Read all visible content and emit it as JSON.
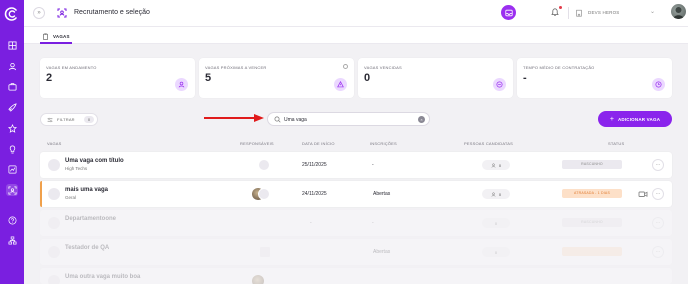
{
  "header": {
    "title": "Recrutamento e seleção",
    "company": "DEVS HEROS"
  },
  "tabs": [
    {
      "label": "VAGAS",
      "active": true
    }
  ],
  "stats": [
    {
      "label": "VAGAS EM ANDAMENTO",
      "value": "2"
    },
    {
      "label": "VAGAS PRÓXIMAS A VENCER",
      "value": "5"
    },
    {
      "label": "VAGAS VENCIDAS",
      "value": "0"
    },
    {
      "label": "TEMPO MÉDIO DE CONTRATAÇÃO",
      "value": "-"
    }
  ],
  "toolbar": {
    "filter_label": "FILTRAR",
    "filter_count": "0",
    "search_value": "Uma vaga",
    "add_label": "ADICIONAR VAGA"
  },
  "table": {
    "columns": [
      "VAGAS",
      "RESPONSÁVEIS",
      "DATA DE INÍCIO",
      "INSCRIÇÕES",
      "PESSOAS CANDIDATAS",
      "STATUS"
    ],
    "rows": [
      {
        "title": "Uma vaga com título",
        "subtitle": "High Techs",
        "date": "25/11/2025",
        "inscricoes": "-",
        "candidatas": "0",
        "status": "RASCUNHO",
        "faded": false
      },
      {
        "title": "mais uma vaga",
        "subtitle": "Geral",
        "date": "24/11/2025",
        "inscricoes": "Abertas",
        "candidatas": "0",
        "status": "ATRASADA - 1 DIAS",
        "faded": false
      },
      {
        "title": "Departamentoone",
        "subtitle": "",
        "date": "-",
        "inscricoes": "-",
        "candidatas": "0",
        "status": "RASCUNHO",
        "faded": true
      },
      {
        "title": "Testador de QA",
        "subtitle": "",
        "date": "",
        "inscricoes": "Abertas",
        "candidatas": "0",
        "status": "",
        "faded": true
      },
      {
        "title": "Uma outra vaga muito boa",
        "subtitle": "",
        "date": "",
        "inscricoes": "",
        "candidatas": "",
        "status": "",
        "faded": true
      }
    ]
  },
  "colors": {
    "brand": "#7a1fe0",
    "accent": "#8a24ec",
    "warn": "#f0a04b"
  }
}
